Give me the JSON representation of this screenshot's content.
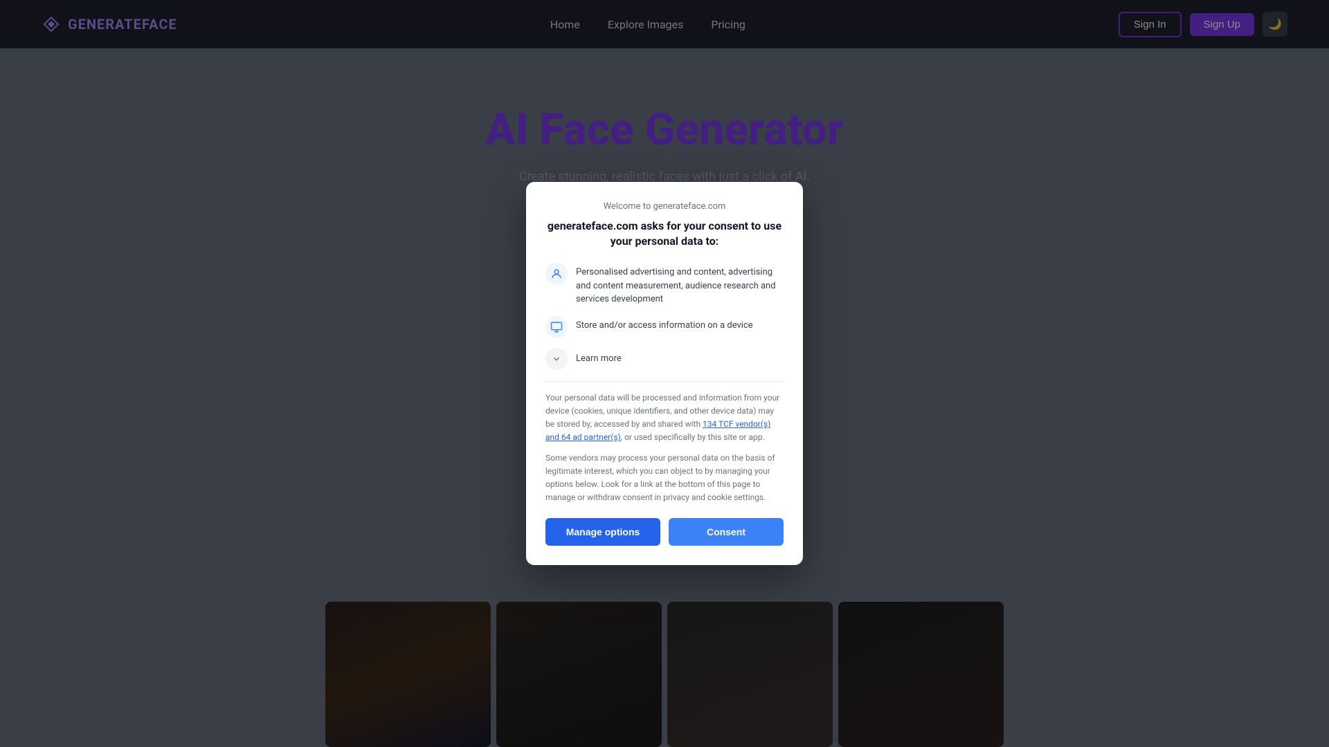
{
  "navbar": {
    "logo_prefix": "GENERATE",
    "logo_suffix": "FACE",
    "nav_items": [
      {
        "label": "Home",
        "id": "home"
      },
      {
        "label": "Explore Images",
        "id": "explore"
      },
      {
        "label": "Pricing",
        "id": "pricing"
      }
    ],
    "signin_label": "Sign In",
    "signup_label": "Sign Up",
    "dark_toggle_icon": "🌙"
  },
  "hero": {
    "title": "AI Face Generator",
    "subtitle": "Create stunning, realistic faces with just a click of AI."
  },
  "consent_modal": {
    "header": "Welcome to generateface.com",
    "title": "generateface.com asks for your consent to use your personal data to:",
    "items": [
      {
        "icon": "👤",
        "text": "Personalised advertising and content, advertising and content measurement, audience research and services development"
      },
      {
        "icon": "💾",
        "text": "Store and/or access information on a device"
      }
    ],
    "learn_more_label": "Learn more",
    "divider": true,
    "body_text_1": "Your personal data will be processed and information from your device (cookies, unique identifiers, and other device data) may be stored by, accessed by and shared with ",
    "link_text": "134 TCF vendor(s) and 64 ad partner(s)",
    "body_text_2": ", or used specifically by this site or app.",
    "body_text_3": "Some vendors may process your personal data on the basis of legitimate interest, which you can object to by managing your options below. Look for a link at the bottom of this page to manage or withdraw consent in privacy and cookie settings.",
    "manage_options_label": "Manage options",
    "consent_label": "Consent"
  }
}
